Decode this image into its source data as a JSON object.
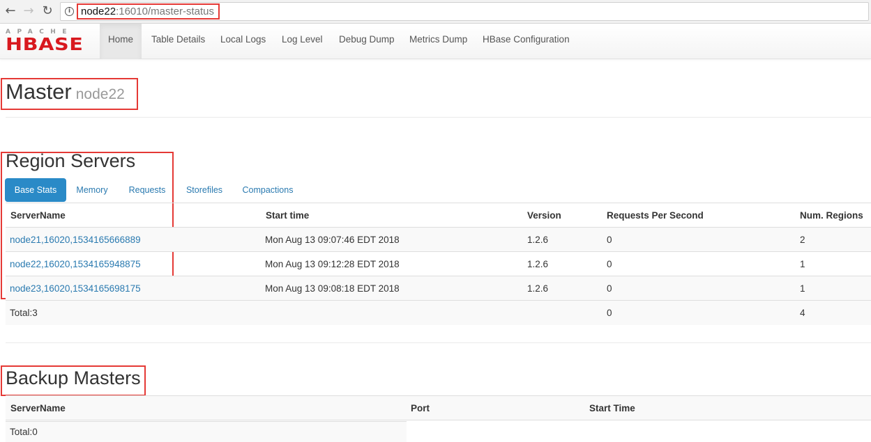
{
  "browser": {
    "url_host": "node22",
    "url_rest": ":16010/master-status",
    "back_glyph": "←",
    "forward_glyph": "→",
    "reload_glyph": "↻",
    "info_glyph": "i"
  },
  "logo": {
    "top": "APACHE",
    "main": "HBASE"
  },
  "nav": {
    "items": [
      "Home",
      "Table Details",
      "Local Logs",
      "Log Level",
      "Debug Dump",
      "Metrics Dump",
      "HBase Configuration"
    ],
    "active": "Home"
  },
  "master": {
    "title": "Master",
    "host": "node22"
  },
  "region_servers": {
    "title": "Region Servers",
    "tabs": [
      "Base Stats",
      "Memory",
      "Requests",
      "Storefiles",
      "Compactions"
    ],
    "active_tab": "Base Stats",
    "columns": [
      "ServerName",
      "Start time",
      "Version",
      "Requests Per Second",
      "Num. Regions"
    ],
    "rows": [
      {
        "server": "node21,16020,1534165666889",
        "start": "Mon Aug 13 09:07:46 EDT 2018",
        "version": "1.2.6",
        "rps": "0",
        "regions": "2"
      },
      {
        "server": "node22,16020,1534165948875",
        "start": "Mon Aug 13 09:12:28 EDT 2018",
        "version": "1.2.6",
        "rps": "0",
        "regions": "1"
      },
      {
        "server": "node23,16020,1534165698175",
        "start": "Mon Aug 13 09:08:18 EDT 2018",
        "version": "1.2.6",
        "rps": "0",
        "regions": "1"
      }
    ],
    "total": {
      "label": "Total:3",
      "rps": "0",
      "regions": "4"
    }
  },
  "backup_masters": {
    "title": "Backup Masters",
    "columns": [
      "ServerName",
      "Port",
      "Start Time"
    ],
    "total": "Total:0"
  },
  "colors": {
    "highlight": "#e53935",
    "link": "#2a7ab0",
    "tab_active": "#2a8ac7",
    "logo_red": "#d8191f"
  }
}
